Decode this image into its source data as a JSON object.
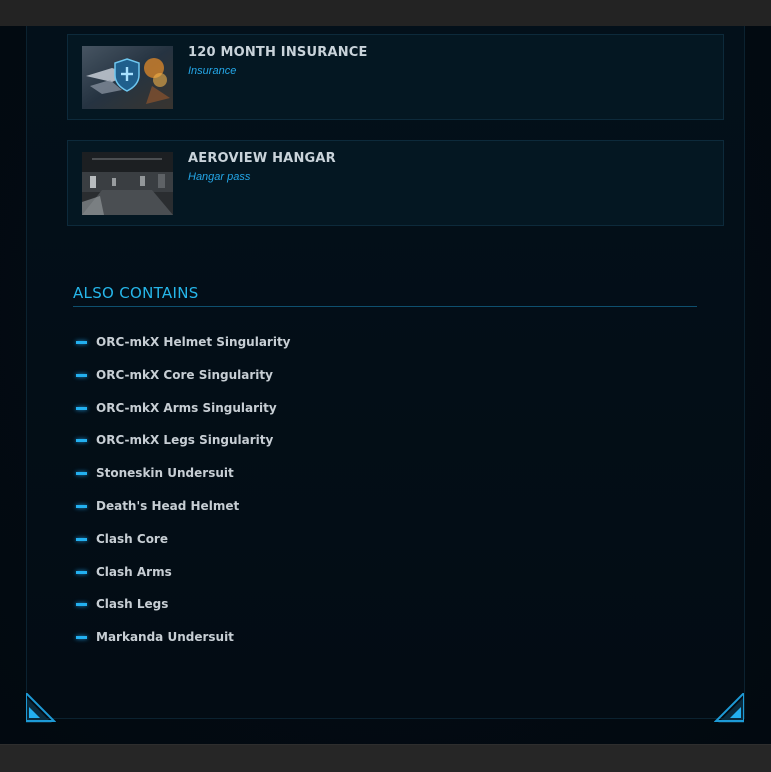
{
  "items": [
    {
      "title": "120 MONTH INSURANCE",
      "subtitle": "Insurance",
      "image": "insurance-shield-thumbnail"
    },
    {
      "title": "AEROVIEW HANGAR",
      "subtitle": "Hangar pass",
      "image": "hangar-interior-thumbnail"
    }
  ],
  "also_contains": {
    "heading": "ALSO CONTAINS",
    "entries": [
      "ORC-mkX Helmet Singularity",
      "ORC-mkX Core Singularity",
      "ORC-mkX Arms Singularity",
      "ORC-mkX Legs Singularity",
      "Stoneskin Undersuit",
      "Death's Head Helmet",
      "Clash Core",
      "Clash Arms",
      "Clash Legs",
      "Markanda Undersuit"
    ]
  },
  "colors": {
    "accent": "#26b6ea",
    "bullet": "#23b0f0",
    "text": "#c7ced4",
    "subtitle": "#24a7e8"
  },
  "icons": {
    "bullet": "dash-bullet-icon",
    "corners": "corner-bracket-icon"
  }
}
